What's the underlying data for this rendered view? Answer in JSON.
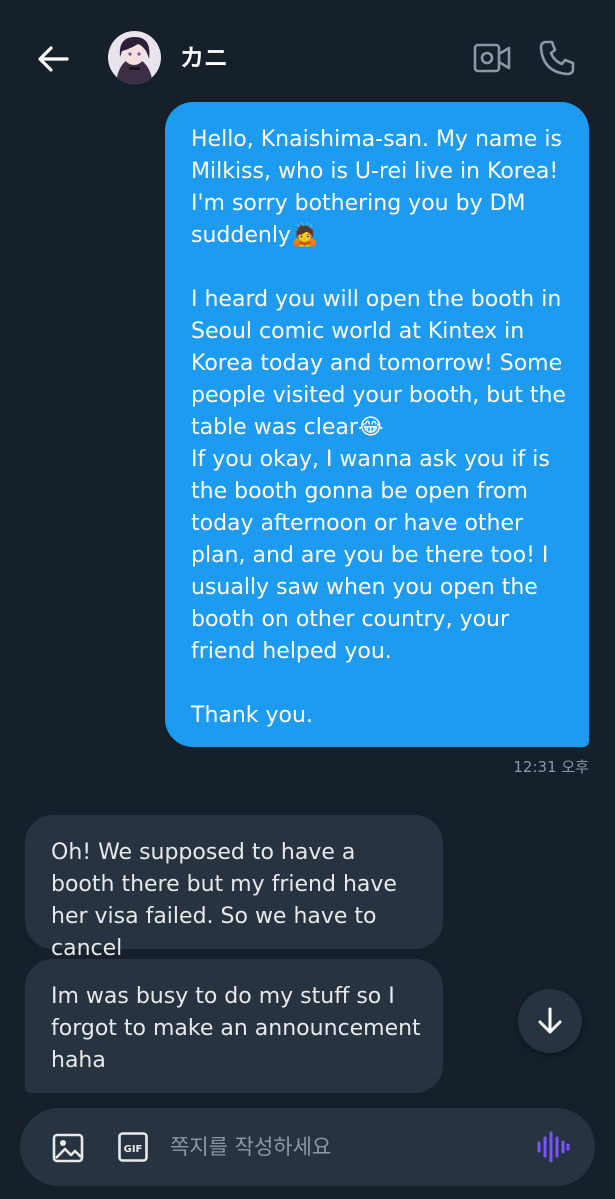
{
  "header": {
    "contact_name": "カニ",
    "back_icon": "arrow-left-icon",
    "video_icon": "video-camera-icon",
    "call_icon": "phone-icon"
  },
  "messages": [
    {
      "direction": "outgoing",
      "text": "Hello, Knaishima-san. My name is Milkiss, who is U-rei live in Korea! I'm sorry bothering you by DM suddenly🙇\n\nI heard you will open the booth in Seoul comic world at Kintex in Korea today and tomorrow! Some people visited your booth, but the table was clear😂\nIf you okay, I wanna ask you if is the booth gonna be open from today afternoon or have other plan, and are you be there too! I usually saw when you open the booth on other country, your friend helped you.\n\nThank you.",
      "timestamp": "12:31 오후"
    },
    {
      "direction": "incoming",
      "text": "Oh! We supposed to have a booth there but my friend have her visa failed. So we have to cancel"
    },
    {
      "direction": "incoming",
      "text": "Im was busy to do my stuff so I forgot to make an announcement haha"
    }
  ],
  "composer": {
    "placeholder": "쪽지를 작성하세요",
    "media_icon": "image-icon",
    "gif_icon": "gif-icon",
    "voice_icon": "voice-wave-icon"
  },
  "scroll_icon": "arrow-down-icon",
  "colors": {
    "background": "#15202b",
    "outgoing_bubble": "#1d9bf0",
    "incoming_bubble": "#273340",
    "voice_accent": "#7856ff"
  }
}
